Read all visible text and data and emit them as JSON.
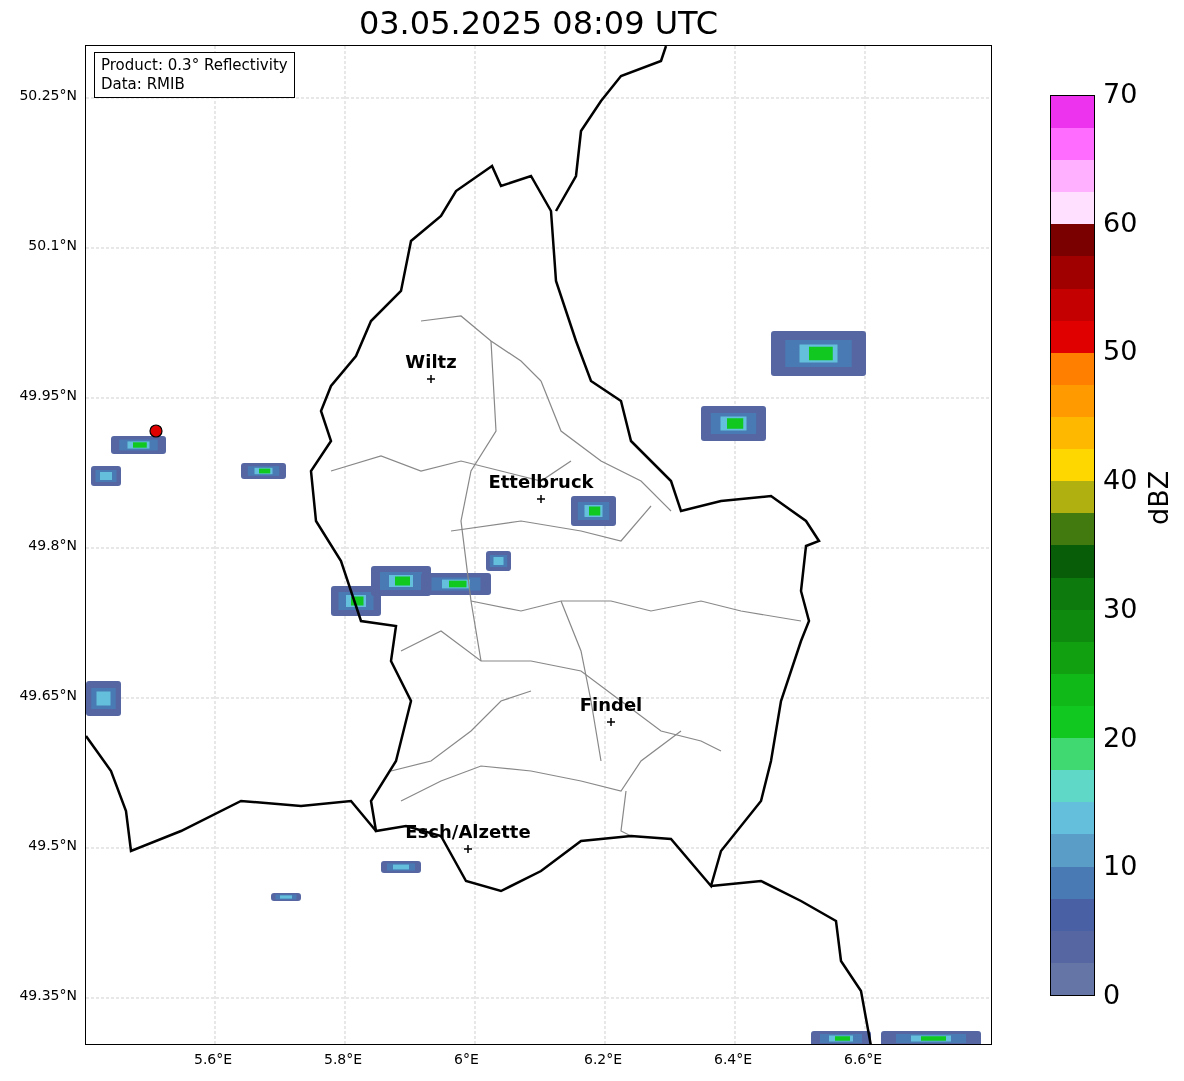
{
  "title": "03.05.2025 08:09 UTC",
  "legend": [
    "Product: 0.3° Reflectivity",
    "Data: RMIB"
  ],
  "map": {
    "y_ticks": [
      "50.25°N",
      "50.1°N",
      "49.95°N",
      "49.8°N",
      "49.65°N",
      "49.5°N",
      "49.35°N"
    ],
    "x_ticks": [
      "5.6°E",
      "5.8°E",
      "6°E",
      "6.2°E",
      "6.4°E",
      "6.6°E"
    ],
    "cities": [
      {
        "name": "Wiltz"
      },
      {
        "name": "Ettelbruck"
      },
      {
        "name": "Findel"
      },
      {
        "name": "Esch/Alzette"
      }
    ]
  },
  "colorbar": {
    "label": "dBZ",
    "ticks": [
      "70",
      "60",
      "50",
      "40",
      "30",
      "20",
      "10",
      "0"
    ],
    "bands": [
      {
        "color": "#6475a6"
      },
      {
        "color": "#5566a2"
      },
      {
        "color": "#4a60a4"
      },
      {
        "color": "#4a7ab4"
      },
      {
        "color": "#5a9ec8"
      },
      {
        "color": "#63bfdc"
      },
      {
        "color": "#60d8c8"
      },
      {
        "color": "#40d870"
      },
      {
        "color": "#10c820"
      },
      {
        "color": "#10b818"
      },
      {
        "color": "#10a010"
      },
      {
        "color": "#0e8a0e"
      },
      {
        "color": "#0c7a0c"
      },
      {
        "color": "#085e08"
      },
      {
        "color": "#437a10"
      },
      {
        "color": "#b0b010"
      },
      {
        "color": "#ffd700"
      },
      {
        "color": "#ffb800"
      },
      {
        "color": "#ff9a00"
      },
      {
        "color": "#ff7f00"
      },
      {
        "color": "#e00000"
      },
      {
        "color": "#c40000"
      },
      {
        "color": "#a00000"
      },
      {
        "color": "#7a0000"
      },
      {
        "color": "#ffe0ff"
      },
      {
        "color": "#ffb0ff"
      },
      {
        "color": "#ff6cff"
      },
      {
        "color": "#ee33ee"
      }
    ]
  }
}
